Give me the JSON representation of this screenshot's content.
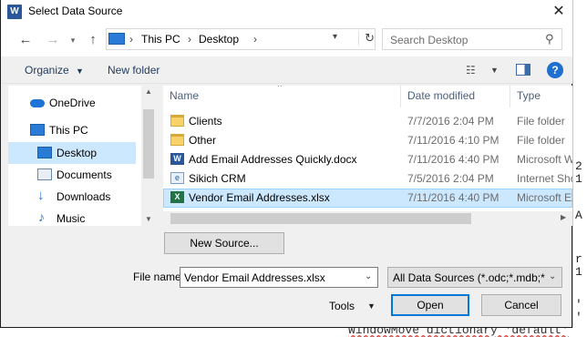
{
  "window": {
    "title": "Select Data Source",
    "app_icon": "word-icon"
  },
  "nav": {
    "breadcrumb": [
      "This PC",
      "Desktop"
    ],
    "search_placeholder": "Search Desktop"
  },
  "toolbar": {
    "organize_label": "Organize",
    "new_folder_label": "New folder"
  },
  "sidebar": {
    "items": [
      {
        "label": "OneDrive",
        "icon": "cloud-icon"
      },
      {
        "label": "This PC",
        "icon": "computer-icon"
      },
      {
        "label": "Desktop",
        "icon": "desktop-icon",
        "selected": true
      },
      {
        "label": "Documents",
        "icon": "documents-icon"
      },
      {
        "label": "Downloads",
        "icon": "downloads-icon"
      },
      {
        "label": "Music",
        "icon": "music-icon"
      }
    ]
  },
  "files": {
    "columns": [
      "Name",
      "Date modified",
      "Type"
    ],
    "rows": [
      {
        "name": "Clients",
        "date": "7/7/2016 2:04 PM",
        "type": "File folder",
        "icon": "folder-icon"
      },
      {
        "name": "Other",
        "date": "7/11/2016 4:10 PM",
        "type": "File folder",
        "icon": "folder-icon"
      },
      {
        "name": "Add Email Addresses Quickly.docx",
        "date": "7/11/2016 4:40 PM",
        "type": "Microsoft W",
        "icon": "word-doc-icon"
      },
      {
        "name": "Sikich CRM",
        "date": "7/5/2016 2:04 PM",
        "type": "Internet Sho",
        "icon": "internet-shortcut-icon"
      },
      {
        "name": "Vendor Email Addresses.xlsx",
        "date": "7/11/2016 4:40 PM",
        "type": "Microsoft Ex",
        "icon": "excel-icon",
        "selected": true
      }
    ]
  },
  "bottom": {
    "new_source_label": "New Source...",
    "file_name_label": "File name:",
    "file_name_value": "Vendor Email Addresses.xlsx",
    "filter_value": "All Data Sources (*.odc;*.mdb;*",
    "tools_label": "Tools",
    "open_label": "Open",
    "cancel_label": "Cancel"
  },
  "background_doc": {
    "fragments": [
      "2",
      "1",
      "A",
      "r",
      "1",
      "'",
      "'"
    ],
    "bottom_line": "WindowMove dictionary 'default'"
  },
  "colors": {
    "selection": "#cce8ff",
    "accent": "#0078d7",
    "title_link": "#1e395b"
  }
}
